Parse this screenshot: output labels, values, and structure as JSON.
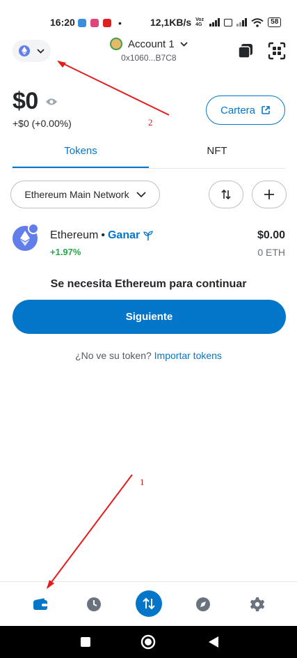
{
  "status_bar": {
    "time": "16:20",
    "dot": "•",
    "speed": "12,1KB/s",
    "network_tag": "Voz 4G",
    "battery": "58"
  },
  "header": {
    "account_name": "Account 1",
    "account_address": "0x1060...B7C8"
  },
  "balance": {
    "amount": "$0",
    "change": "+$0 (+0.00%)"
  },
  "portfolio_button": "Cartera",
  "tabs": [
    "Tokens",
    "NFT"
  ],
  "network_filter": "Ethereum Main Network",
  "token": {
    "name": "Ethereum",
    "separator": "•",
    "earn_label": "Ganar",
    "change": "+1.97%",
    "value": "$0.00",
    "amount": "0 ETH"
  },
  "prompt_text": "Se necesita Ethereum para continuar",
  "next_button": "Siguiente",
  "import": {
    "question": "¿No ve su token?",
    "link": "Importar tokens"
  },
  "annotations": {
    "label_1": "1",
    "label_2": "2"
  },
  "colors": {
    "accent": "#0376c9",
    "positive": "#28a745",
    "annotation": "#e31b1b",
    "eth": "#627eea"
  },
  "icons": {
    "bottom_nav": [
      "wallet-icon",
      "clock-icon",
      "swap-icon",
      "compass-icon",
      "gear-icon"
    ]
  }
}
